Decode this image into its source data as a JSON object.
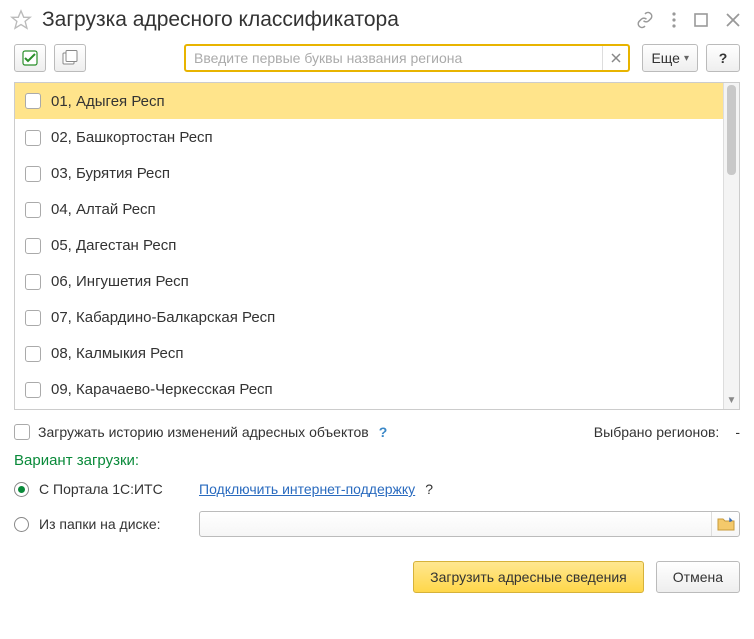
{
  "title": "Загрузка адресного классификатора",
  "toolbar": {
    "more_label": "Еще",
    "help_label": "?"
  },
  "search": {
    "placeholder": "Введите первые буквы названия региона",
    "value": ""
  },
  "regions": [
    {
      "label": "01, Адыгея Респ",
      "selected": true
    },
    {
      "label": "02, Башкортостан Респ",
      "selected": false
    },
    {
      "label": "03, Бурятия Респ",
      "selected": false
    },
    {
      "label": "04, Алтай Респ",
      "selected": false
    },
    {
      "label": "05, Дагестан Респ",
      "selected": false
    },
    {
      "label": "06, Ингушетия Респ",
      "selected": false
    },
    {
      "label": "07, Кабардино-Балкарская Респ",
      "selected": false
    },
    {
      "label": "08, Калмыкия Респ",
      "selected": false
    },
    {
      "label": "09, Карачаево-Черкесская Респ",
      "selected": false
    }
  ],
  "options": {
    "history_label": "Загружать историю изменений адресных объектов",
    "help": "?",
    "selected_label": "Выбрано регионов:",
    "selected_count": "-"
  },
  "variant": {
    "title": "Вариант загрузки:",
    "portal_label": "С Портала 1С:ИТС",
    "connect_link": "Подключить интернет-поддержку",
    "connect_help": "?",
    "folder_label": "Из папки на диске:",
    "folder_value": ""
  },
  "footer": {
    "load_label": "Загрузить адресные сведения",
    "cancel_label": "Отмена"
  }
}
